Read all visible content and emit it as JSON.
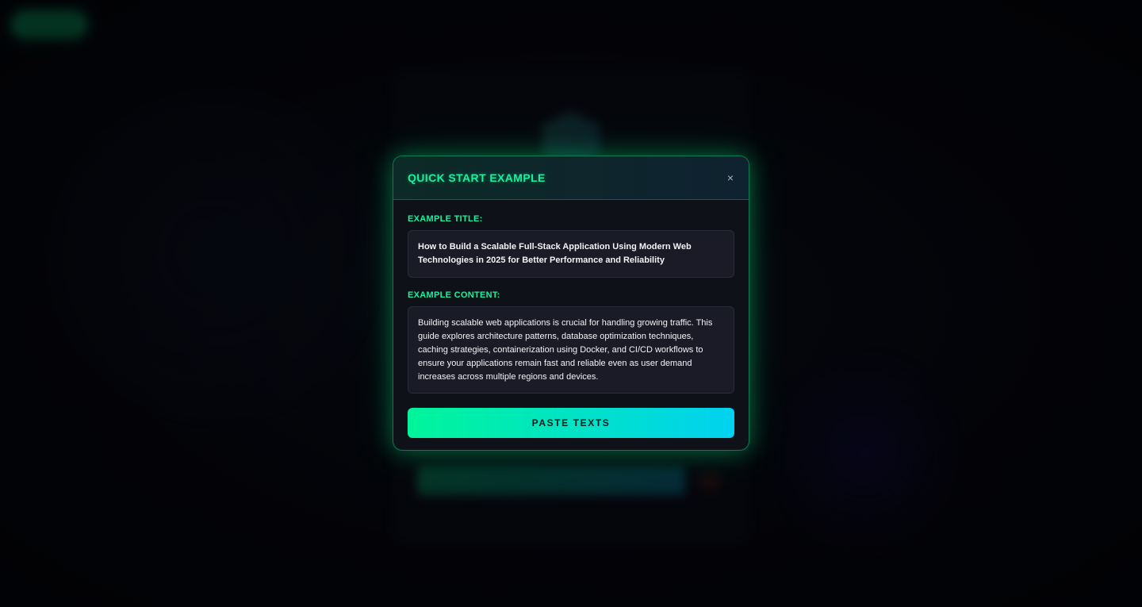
{
  "modal": {
    "title": "QUICK START EXAMPLE",
    "close_icon": "×",
    "title_label": "EXAMPLE TITLE:",
    "title_text": "How to Build a Scalable Full-Stack Application Using Modern Web Technologies in 2025 for Better Performance and Reliability",
    "content_label": "EXAMPLE CONTENT:",
    "content_text": "Building scalable web applications is crucial for handling growing traffic. This guide explores architecture patterns, database optimization techniques, caching strategies, containerization using Docker, and CI/CD workflows to ensure your applications remain fast and reliable even as user demand increases across multiple regions and devices.",
    "paste_button_label": "PASTE TEXTS"
  },
  "colors": {
    "accent_green": "#19f0a0",
    "button_gradient_start": "#00f59a",
    "button_gradient_end": "#00d2f0",
    "background": "#04050a"
  },
  "icons": {
    "close": "close-icon",
    "background_logo": "hexagon-logo-icon"
  }
}
